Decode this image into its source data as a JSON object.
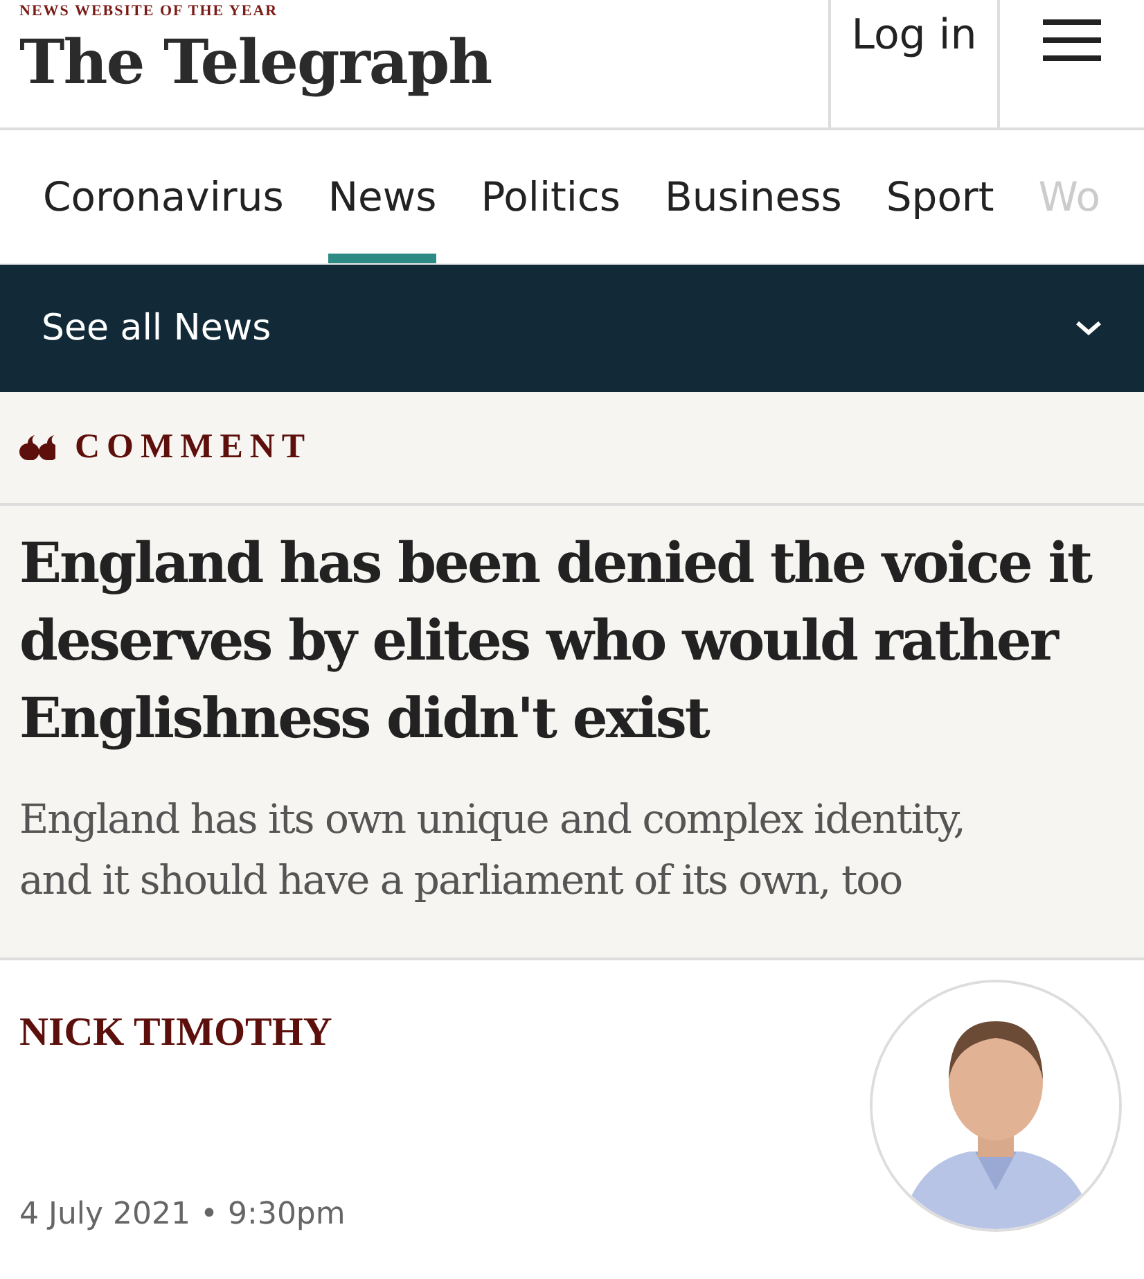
{
  "masthead": {
    "tagline": "NEWS WEBSITE OF THE YEAR",
    "logo": "The Telegraph",
    "login": "Log in"
  },
  "nav": {
    "tabs": [
      {
        "label": "Coronavirus",
        "selected": false
      },
      {
        "label": "News",
        "selected": true
      },
      {
        "label": "Politics",
        "selected": false
      },
      {
        "label": "Business",
        "selected": false
      },
      {
        "label": "Sport",
        "selected": false
      },
      {
        "label": "Wo",
        "selected": false
      }
    ]
  },
  "section_bar": {
    "label": "See all News",
    "expanded": false
  },
  "article": {
    "category": "COMMENT",
    "headline": "England has been denied the voice it deserves by elites who would rather Englishness didn't exist",
    "standfirst": "England has its own unique and complex identity, and it should have a parliament of its own, too"
  },
  "byline": {
    "author": "NICK TIMOTHY",
    "date": "4 July 2021",
    "separator": "•",
    "time": "9:30pm"
  }
}
